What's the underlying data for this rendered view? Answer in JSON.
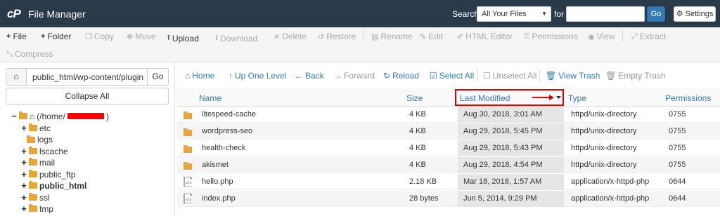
{
  "app": {
    "logo": "cP",
    "title": "File Manager"
  },
  "search": {
    "label": "Search",
    "scope": "All Your Files",
    "for_label": "for",
    "value": "",
    "go": "Go",
    "settings": "Settings"
  },
  "toolbar": {
    "file": "File",
    "folder": "Folder",
    "copy": "Copy",
    "move": "Move",
    "upload": "Upload",
    "download": "Download",
    "delete": "Delete",
    "restore": "Restore",
    "rename": "Rename",
    "edit": "Edit",
    "html_editor": "HTML Editor",
    "permissions": "Permissions",
    "view": "View",
    "extract": "Extract",
    "compress": "Compress"
  },
  "left": {
    "path": "public_html/wp-content/plugin",
    "go": "Go",
    "collapse": "Collapse All",
    "root": "(/home/",
    "root_suffix": ")",
    "tree": [
      "etc",
      "logs",
      "lscache",
      "mail",
      "public_ftp",
      "public_html",
      "ssl",
      "tmp"
    ]
  },
  "nav": {
    "home": "Home",
    "up": "Up One Level",
    "back": "Back",
    "forward": "Forward",
    "reload": "Reload",
    "select_all": "Select All",
    "unselect_all": "Unselect All",
    "view_trash": "View Trash",
    "empty_trash": "Empty Trash"
  },
  "table": {
    "headers": {
      "name": "Name",
      "size": "Size",
      "last_modified": "Last Modified",
      "type": "Type",
      "permissions": "Permissions"
    },
    "rows": [
      {
        "name": "litespeed-cache",
        "size": "4 KB",
        "modified": "Aug 30, 2018, 3:01 AM",
        "type": "httpd/unix-directory",
        "perm": "0755",
        "kind": "folder"
      },
      {
        "name": "wordpress-seo",
        "size": "4 KB",
        "modified": "Aug 29, 2018, 5:45 PM",
        "type": "httpd/unix-directory",
        "perm": "0755",
        "kind": "folder"
      },
      {
        "name": "health-check",
        "size": "4 KB",
        "modified": "Aug 29, 2018, 5:43 PM",
        "type": "httpd/unix-directory",
        "perm": "0755",
        "kind": "folder"
      },
      {
        "name": "akismet",
        "size": "4 KB",
        "modified": "Aug 29, 2018, 4:54 PM",
        "type": "httpd/unix-directory",
        "perm": "0755",
        "kind": "folder"
      },
      {
        "name": "hello.php",
        "size": "2.18 KB",
        "modified": "Mar 18, 2018, 1:57 AM",
        "type": "application/x-httpd-php",
        "perm": "0644",
        "kind": "file"
      },
      {
        "name": "index.php",
        "size": "28 bytes",
        "modified": "Jun 5, 2014, 9:29 PM",
        "type": "application/x-httpd-php",
        "perm": "0644",
        "kind": "file"
      }
    ]
  },
  "colors": {
    "topbar": "#293a4a",
    "link": "#337ab7",
    "folder": "#e8a735",
    "highlight": "#e00000"
  }
}
